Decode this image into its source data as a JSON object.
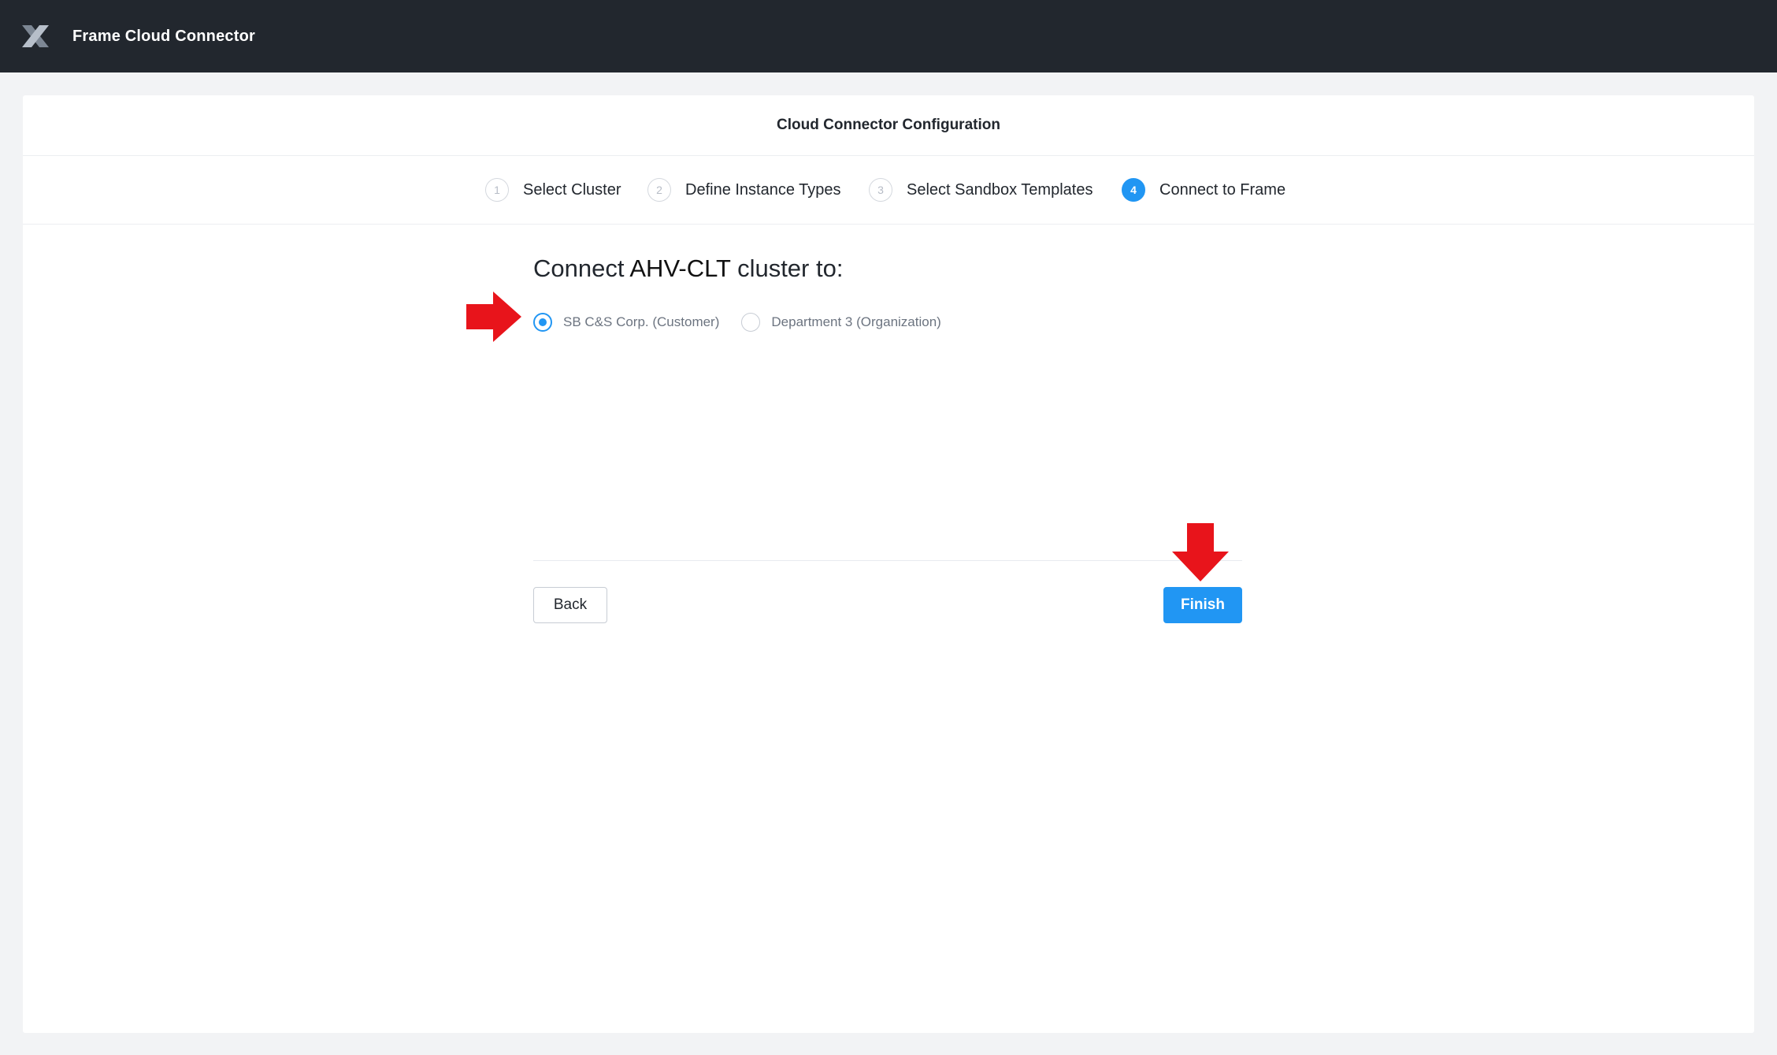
{
  "app": {
    "title": "Frame Cloud Connector",
    "logo_icon": "x-logo-icon"
  },
  "card": {
    "title": "Cloud Connector Configuration"
  },
  "stepper": {
    "steps": [
      {
        "number": "1",
        "label": "Select Cluster",
        "active": false
      },
      {
        "number": "2",
        "label": "Define Instance Types",
        "active": false
      },
      {
        "number": "3",
        "label": "Select Sandbox Templates",
        "active": false
      },
      {
        "number": "4",
        "label": "Connect to Frame",
        "active": true
      }
    ]
  },
  "connect": {
    "heading_prefix": "Connect",
    "cluster_name": "AHV-CLT",
    "heading_suffix": "cluster to:",
    "options": [
      {
        "label": "SB C&S Corp. (Customer)",
        "selected": true
      },
      {
        "label": "Department 3 (Organization)",
        "selected": false
      }
    ]
  },
  "footer": {
    "back_label": "Back",
    "finish_label": "Finish"
  },
  "annotations": {
    "arrow_color": "#e8141b"
  },
  "colors": {
    "topbar": "#22272e",
    "accent": "#2196f3"
  }
}
